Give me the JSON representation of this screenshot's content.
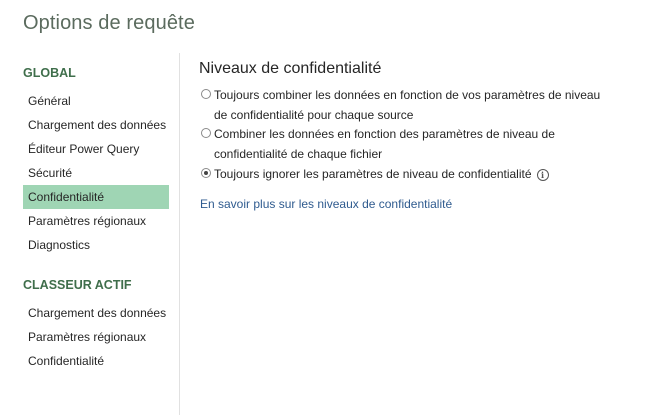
{
  "dialog": {
    "title": "Options de requête"
  },
  "sidebar": {
    "global_header": "GLOBAL",
    "global_items": [
      {
        "label": "Général"
      },
      {
        "label": "Chargement des données"
      },
      {
        "label": "Éditeur Power Query"
      },
      {
        "label": "Sécurité"
      },
      {
        "label": "Confidentialité",
        "selected": true
      },
      {
        "label": "Paramètres régionaux"
      },
      {
        "label": "Diagnostics"
      }
    ],
    "workbook_header": "CLASSEUR ACTIF",
    "workbook_items": [
      {
        "label": "Chargement des données"
      },
      {
        "label": "Paramètres régionaux"
      },
      {
        "label": "Confidentialité"
      }
    ]
  },
  "content": {
    "title": "Niveaux de confidentialité",
    "options": [
      {
        "line1": "Toujours combiner les données en fonction de vos paramètres de niveau",
        "line2": "de confidentialité pour chaque source",
        "checked": false
      },
      {
        "line1": "Combiner les données en fonction des paramètres de niveau de",
        "line2": "confidentialité de chaque fichier",
        "checked": false
      },
      {
        "line1": "Toujours ignorer les paramètres de niveau de confidentialité",
        "checked": true,
        "info_icon": "info-icon"
      }
    ],
    "learn_more_link": "En savoir plus sur les niveaux de confidentialité"
  },
  "colors": {
    "accent_green": "#3f6e4b",
    "selected_bg": "#9fd5b4",
    "link": "#2f5b8f",
    "title": "#5b6b5e"
  }
}
